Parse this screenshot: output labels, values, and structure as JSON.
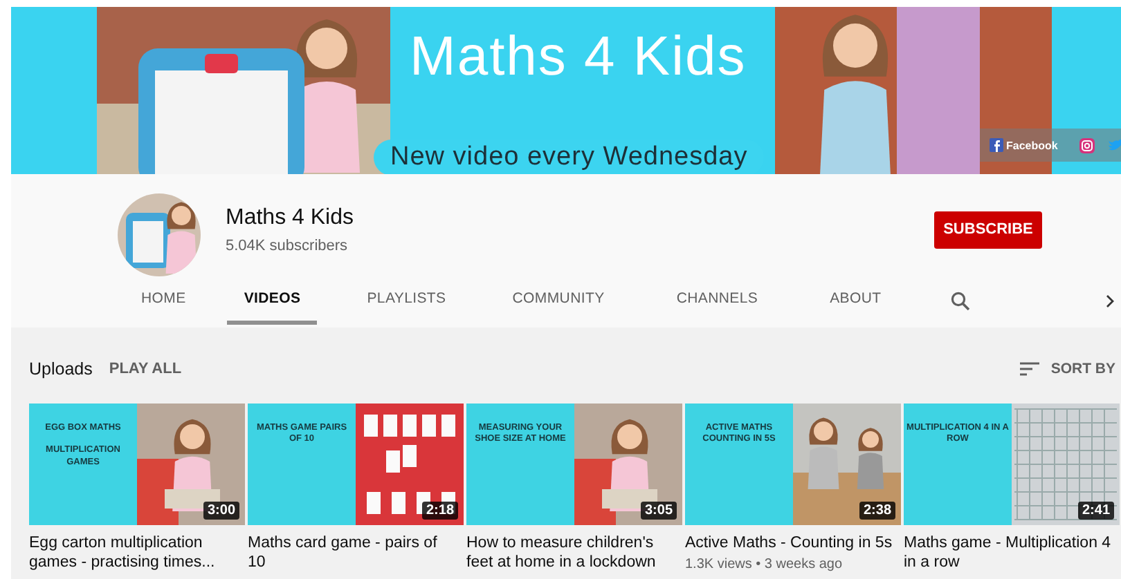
{
  "banner": {
    "title": "Maths 4 Kids",
    "tagline": "New video every Wednesday",
    "links": [
      {
        "kind": "facebook",
        "label": "Facebook"
      },
      {
        "kind": "instagram"
      },
      {
        "kind": "twitter"
      }
    ]
  },
  "channel": {
    "name": "Maths 4 Kids",
    "subscribers": "5.04K subscribers",
    "subscribe_button": "SUBSCRIBE"
  },
  "tabs": [
    {
      "label": "HOME",
      "selected": false
    },
    {
      "label": "VIDEOS",
      "selected": true
    },
    {
      "label": "PLAYLISTS",
      "selected": false
    },
    {
      "label": "COMMUNITY",
      "selected": false
    },
    {
      "label": "CHANNELS",
      "selected": false
    },
    {
      "label": "ABOUT",
      "selected": false
    }
  ],
  "section": {
    "title": "Uploads",
    "play_all": "PLAY ALL",
    "sort": "SORT BY"
  },
  "videos": [
    {
      "caption": [
        "EGG BOX MATHS",
        "MULTIPLICATION GAMES"
      ],
      "duration": "3:00",
      "title": "Egg carton multiplication games - practising times..."
    },
    {
      "caption": [
        "MATHS GAME PAIRS OF 10"
      ],
      "duration": "2:18",
      "title": "Maths card game - pairs of 10"
    },
    {
      "caption": [
        "MEASURING YOUR SHOE SIZE AT HOME"
      ],
      "duration": "3:05",
      "title": "How to measure children's feet at home in a lockdown"
    },
    {
      "caption": [
        "ACTIVE MATHS COUNTING IN 5S"
      ],
      "duration": "2:38",
      "title": "Active Maths - Counting in 5s",
      "meta": "1.3K views • 3 weeks ago"
    },
    {
      "caption": [
        "MULTIPLICATION 4 IN A ROW"
      ],
      "duration": "2:41",
      "title": "Maths game - Multiplication 4 in a row"
    }
  ]
}
